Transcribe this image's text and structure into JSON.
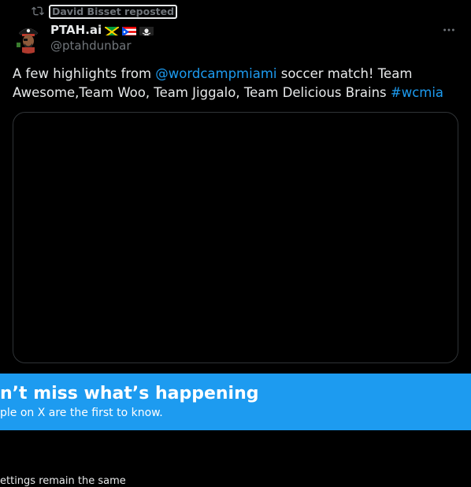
{
  "repost": {
    "icon": "repost-icon",
    "label": "David Bisset reposted"
  },
  "tweet": {
    "avatar_icon": "pirate-avatar",
    "display_name": "PTAH.ai",
    "flags": [
      "jamaica-flag",
      "puerto-rico-flag",
      "pirate-flag"
    ],
    "handle": "@ptahdunbar",
    "more_icon": "more-icon",
    "text_part1": "A few highlights from ",
    "mention": "@wordcampmiami",
    "text_part2": " soccer match! Team Awesome,Team Woo, Team Jiggalo, Team Delicious Brains ",
    "hashtag": "#wcmia"
  },
  "banner": {
    "title": "n’t miss what’s happening",
    "subtitle": "ple on X are the first to know."
  },
  "footer": {
    "text": "ettings remain the same"
  },
  "colors": {
    "accent": "#1d9bf0",
    "text": "#e7e9ea",
    "muted": "#71767b",
    "background": "#000000"
  }
}
